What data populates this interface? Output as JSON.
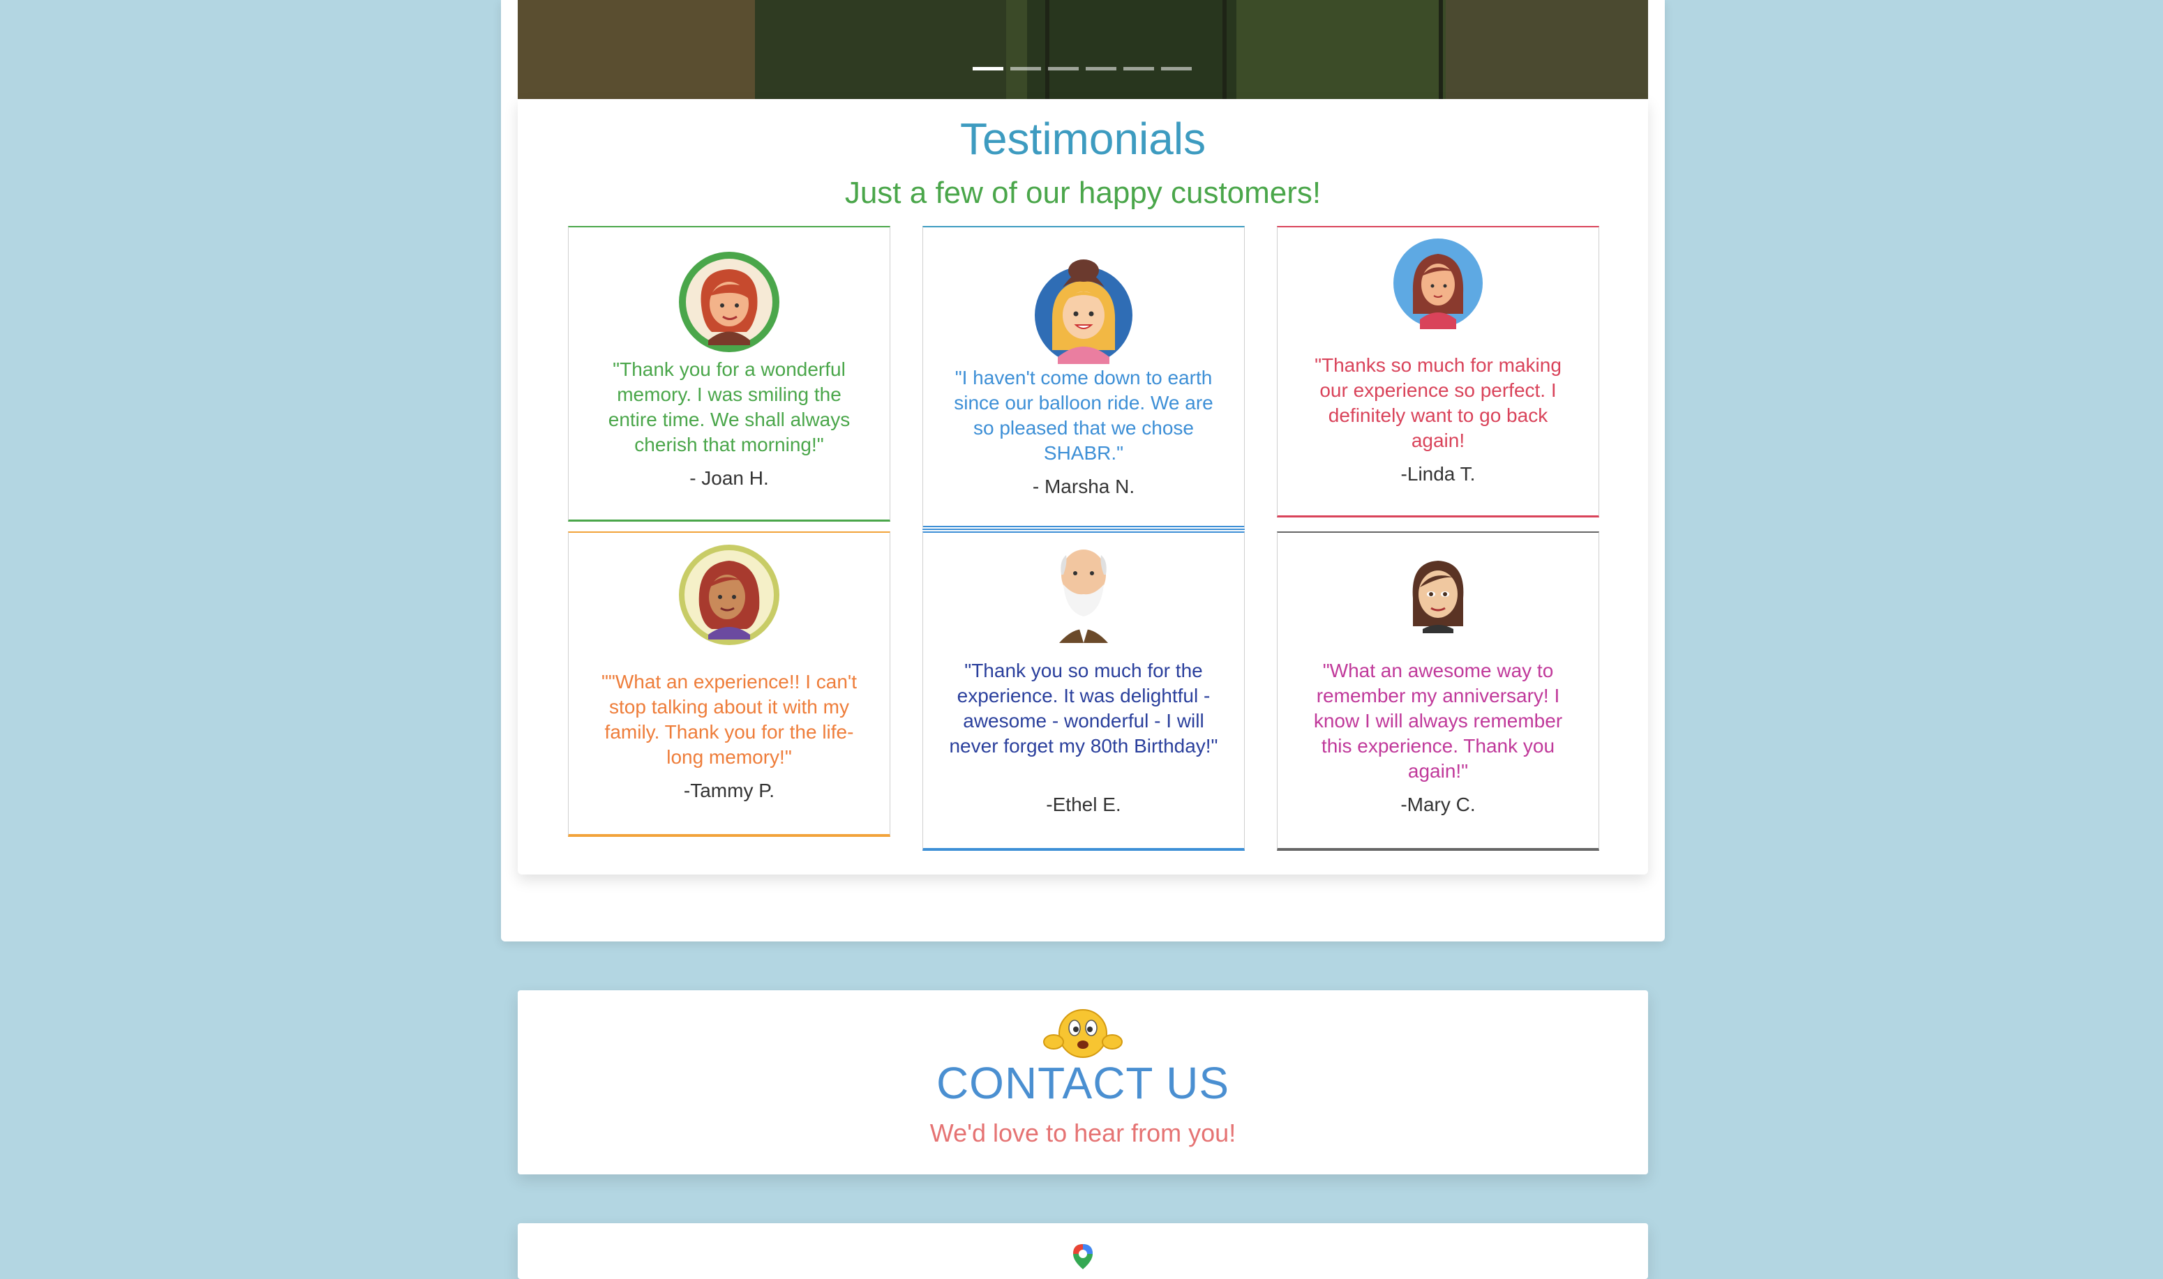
{
  "hero": {
    "slide_count": 6,
    "active_slide": 1
  },
  "testimonials": {
    "title": "Testimonials",
    "subtitle": "Just a few of our happy customers!",
    "items": [
      {
        "quote": "\"Thank you for a wonderful memory. I was smiling the entire time. We shall always cherish that morning!\"",
        "author": "- Joan H.",
        "accent": "#4aa64a",
        "text_color": "#4aa64a"
      },
      {
        "quote": "\"I haven't come down to earth since our balloon ride. We are so pleased that we chose SHABR.\"",
        "author": "- Marsha N.",
        "accent": "#3d8fd6",
        "text_color": "#3d8fd6"
      },
      {
        "quote": "\"Thanks so much for making our experience so perfect. I definitely want to go back again!",
        "author": "-Linda T.",
        "accent": "#d9435a",
        "text_color": "#d9435a"
      },
      {
        "quote": "\"\"What an experience!! I can't stop talking about it with my family. Thank you for the life-long memory!\"",
        "author": "-Tammy P.",
        "accent": "#f2a33a",
        "text_color": "#ee7d3a"
      },
      {
        "quote": "\"Thank you so much for the experience. It was delightful - awesome - wonderful - I will never forget my 80th Birthday!\"",
        "author": "-Ethel E.",
        "accent": "#3d8fd6",
        "text_color": "#2a3f9c"
      },
      {
        "quote": "\"What an awesome way to remember my anniversary! I know I will always remember this experience. Thank you again!\"",
        "author": "-Mary C.",
        "accent": "#666666",
        "text_color": "#c0399a"
      }
    ]
  },
  "contact": {
    "title": "CONTACT US",
    "subtitle": "We'd love to hear from you!",
    "icon": "smiley-emoji-icon"
  },
  "colors": {
    "page_bg": "#b3d6e2",
    "title_blue": "#3d9bc0",
    "subtitle_green": "#4aa64a",
    "contact_blue": "#4a8fd1",
    "contact_pink": "#e57373"
  }
}
